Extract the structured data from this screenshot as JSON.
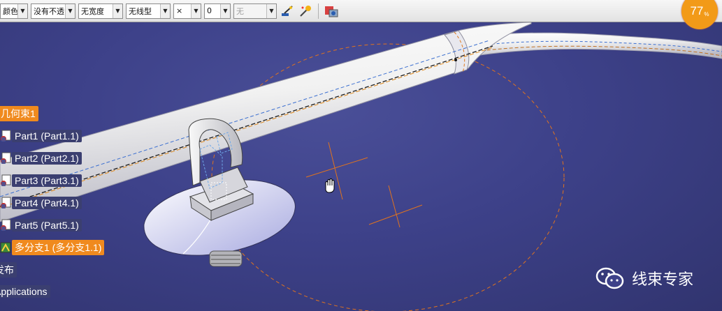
{
  "toolbar": {
    "color_combo": "颜色",
    "transparency_combo": "没有不透",
    "linewidth_combo": "无宽度",
    "linetype_combo": "无线型",
    "point_combo": "×",
    "layer_combo": "0",
    "filter_combo": "无"
  },
  "zoom": {
    "value": "77",
    "unit": "%"
  },
  "tree": {
    "root": "几何束1",
    "items": [
      "Part1 (Part1.1)",
      "Part2 (Part2.1)",
      "Part3 (Part3.1)",
      "Part4 (Part4.1)",
      "Part5 (Part5.1)",
      "多分支1 (多分支1.1)"
    ],
    "publish": "发布",
    "applications": "Applications"
  },
  "watermark": {
    "text": "线束专家"
  },
  "colors": {
    "accent": "#f08a1e",
    "background": "#3d4189",
    "toolbar": "#e6e6e6"
  }
}
